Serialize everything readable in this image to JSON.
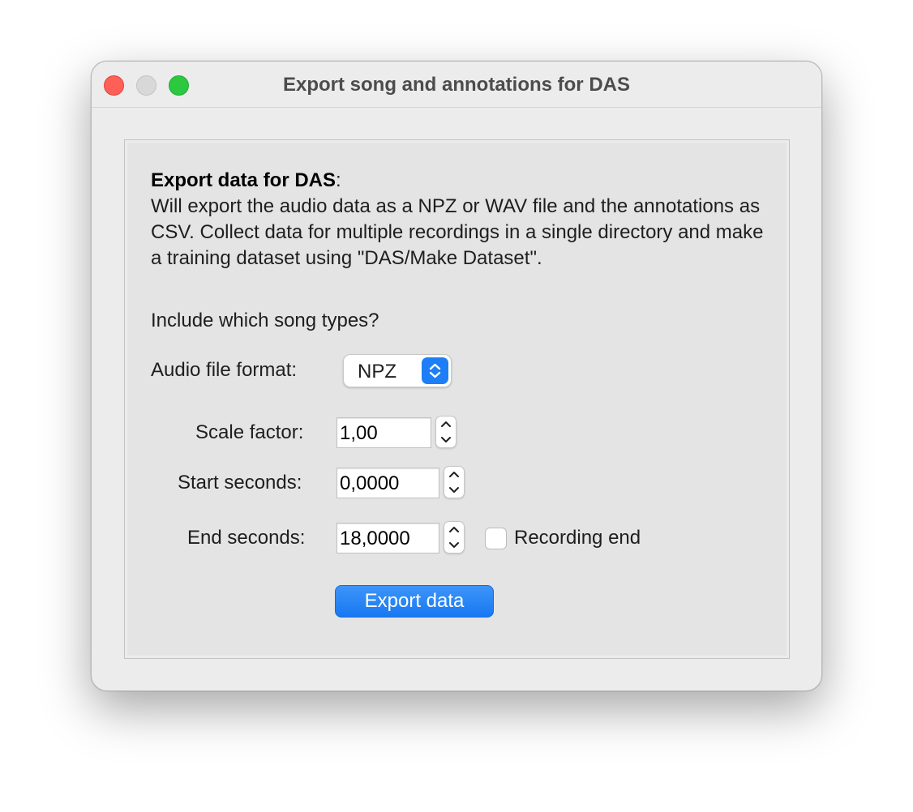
{
  "window": {
    "title": "Export song and annotations for DAS"
  },
  "description": {
    "heading": "Export data for DAS",
    "heading_suffix": ":",
    "body": "Will export the audio data as a NPZ or WAV file and the annotations as CSV. Collect data for multiple recordings in a single directory and make a training dataset using \"DAS/Make Dataset\"."
  },
  "song_types_label": "Include which song types?",
  "audio_format": {
    "label": "Audio file format:",
    "selected": "NPZ"
  },
  "scale_factor": {
    "label": "Scale factor:",
    "value": "1,00"
  },
  "start_seconds": {
    "label": "Start seconds:",
    "value": "0,0000"
  },
  "end_seconds": {
    "label": "End seconds:",
    "value": "18,0000"
  },
  "recording_end": {
    "label": "Recording end",
    "checked": false
  },
  "export_button": {
    "label": "Export data"
  },
  "colors": {
    "accent": "#1d7ef7",
    "close": "#fe5f57",
    "maximize": "#2bc840",
    "window_bg": "#ececec"
  }
}
